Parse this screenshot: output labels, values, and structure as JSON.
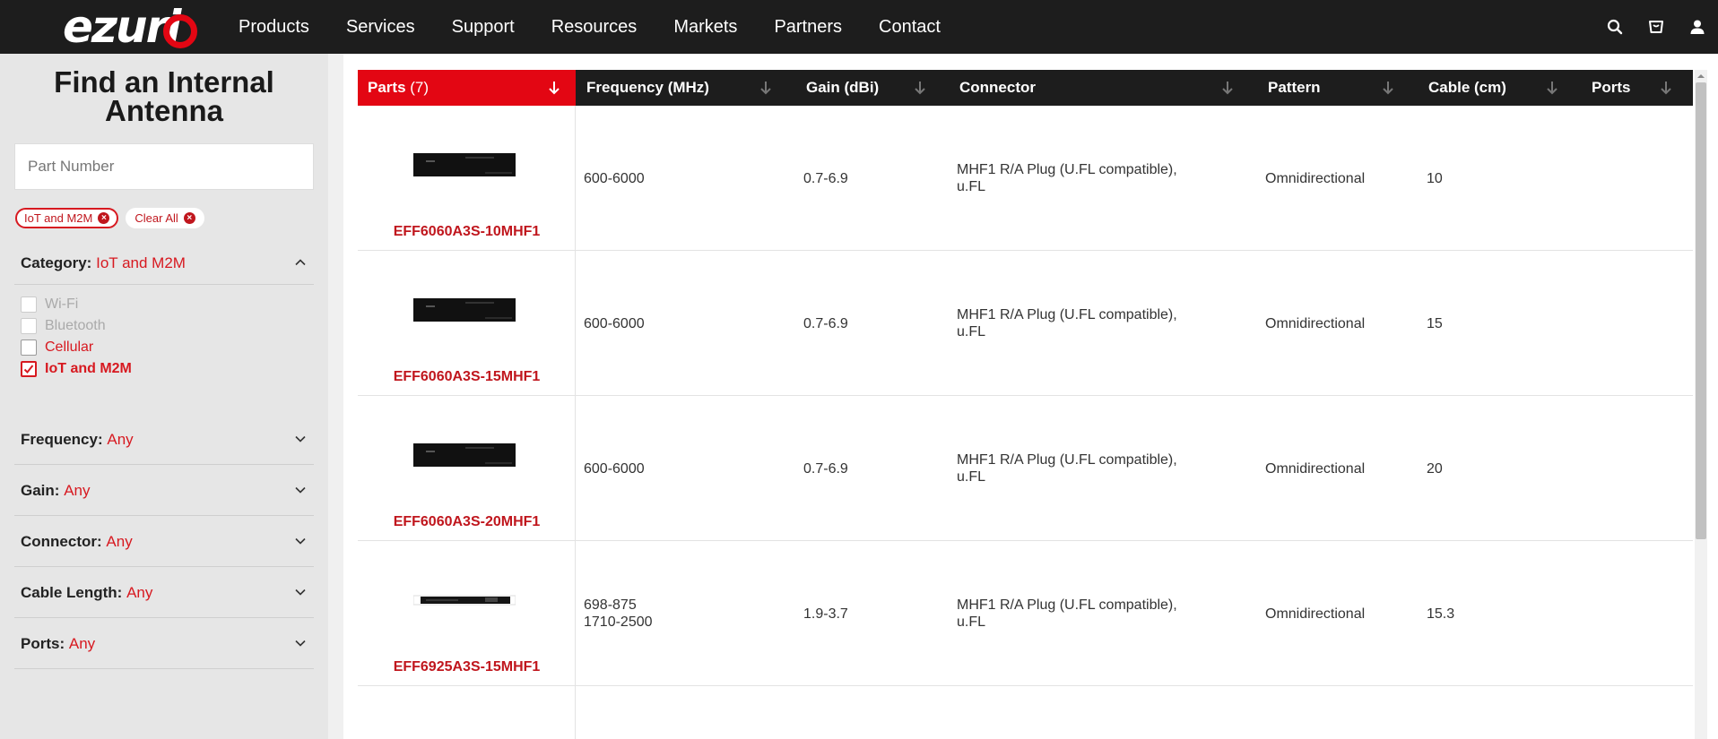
{
  "nav": {
    "logo_text": "ezuri",
    "links": [
      "Products",
      "Services",
      "Support",
      "Resources",
      "Markets",
      "Partners",
      "Contact"
    ],
    "icons": [
      "search-icon",
      "cart-icon",
      "user-icon"
    ]
  },
  "sidebar": {
    "title": "Find an Internal Antenna",
    "search_placeholder": "Part Number",
    "active_filters": [
      {
        "label": "IoT and M2M"
      }
    ],
    "clear_all_label": "Clear All",
    "category": {
      "label": "Category:",
      "value": "IoT and M2M",
      "options": [
        {
          "label": "Wi-Fi",
          "state": "disabled"
        },
        {
          "label": "Bluetooth",
          "state": "disabled"
        },
        {
          "label": "Cellular",
          "state": "available"
        },
        {
          "label": "IoT and M2M",
          "state": "checked"
        }
      ]
    },
    "facets": [
      {
        "label": "Frequency:",
        "value": "Any"
      },
      {
        "label": "Gain:",
        "value": "Any"
      },
      {
        "label": "Connector:",
        "value": "Any"
      },
      {
        "label": "Cable Length:",
        "value": "Any"
      },
      {
        "label": "Ports:",
        "value": "Any"
      }
    ]
  },
  "table": {
    "headers": {
      "parts": "Parts",
      "parts_count": "(7)",
      "frequency": "Frequency (MHz)",
      "gain": "Gain (dBi)",
      "connector": "Connector",
      "pattern": "Pattern",
      "cable": "Cable (cm)",
      "ports": "Ports"
    },
    "rows": [
      {
        "part": "EFF6060A3S-10MHF1",
        "frequency": "600-6000",
        "gain": "0.7-6.9",
        "connector": "MHF1 R/A Plug (U.FL compatible), u.FL",
        "pattern": "Omnidirectional",
        "cable": "10",
        "ports": ""
      },
      {
        "part": "EFF6060A3S-15MHF1",
        "frequency": "600-6000",
        "gain": "0.7-6.9",
        "connector": "MHF1 R/A Plug (U.FL compatible), u.FL",
        "pattern": "Omnidirectional",
        "cable": "15",
        "ports": ""
      },
      {
        "part": "EFF6060A3S-20MHF1",
        "frequency": "600-6000",
        "gain": "0.7-6.9",
        "connector": "MHF1 R/A Plug (U.FL compatible), u.FL",
        "pattern": "Omnidirectional",
        "cable": "20",
        "ports": ""
      },
      {
        "part": "EFF6925A3S-15MHF1",
        "frequency": "698-875\n1710-2500",
        "gain": "1.9-3.7",
        "connector": "MHF1 R/A Plug (U.FL compatible), u.FL",
        "pattern": "Omnidirectional",
        "cable": "15.3",
        "ports": ""
      }
    ]
  },
  "colors": {
    "brand_red": "#e30613",
    "nav_bg": "#1d1d1d",
    "sidebar_bg": "#e6e6e6"
  }
}
